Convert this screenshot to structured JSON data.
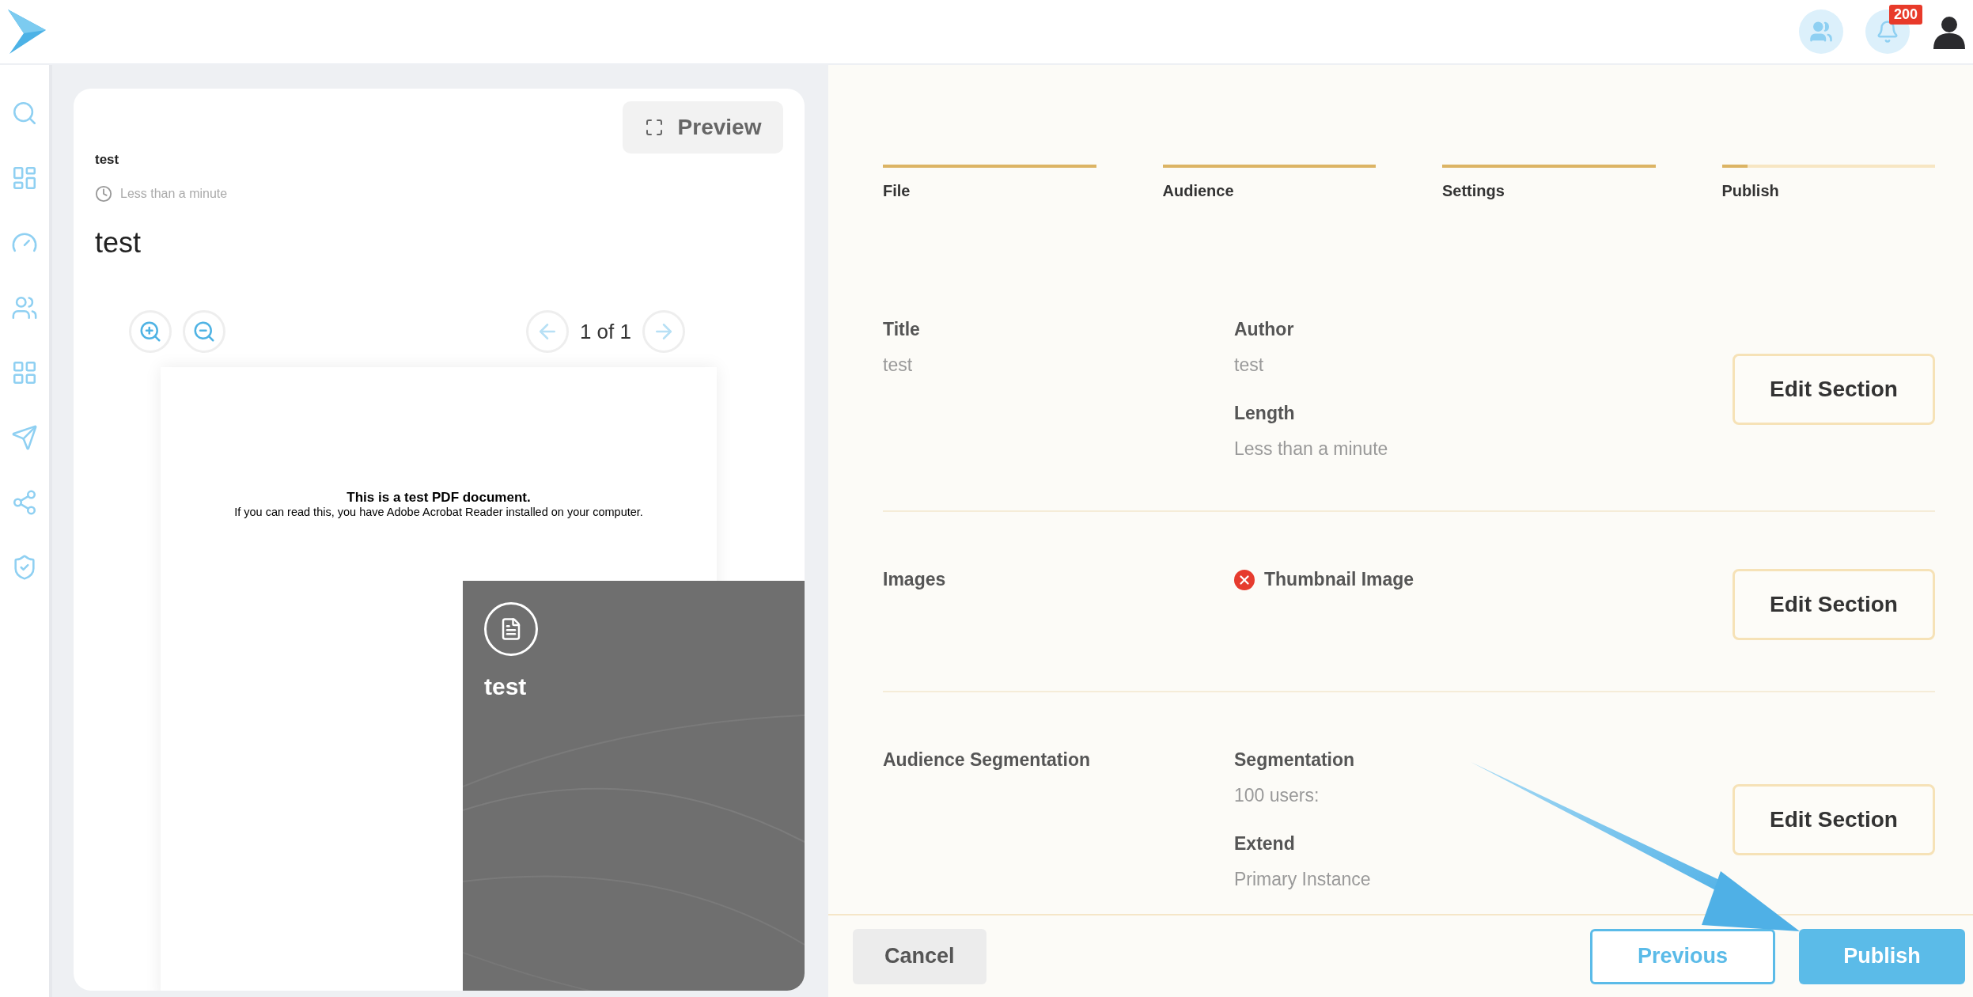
{
  "top_bar": {
    "notification_badge": "200"
  },
  "sidebar": {
    "items": [
      {
        "kind": "search"
      },
      {
        "kind": "dashboard"
      },
      {
        "kind": "gauge"
      },
      {
        "kind": "users"
      },
      {
        "kind": "apps"
      },
      {
        "kind": "send"
      },
      {
        "kind": "share"
      },
      {
        "kind": "shield"
      }
    ]
  },
  "preview_card": {
    "preview_button": "Preview",
    "small_title": "test",
    "duration": "Less than a minute",
    "title": "test",
    "page_indicator": "1 of 1",
    "pdf_page": {
      "heading": "This is a test PDF document.",
      "text": "If you can read this, you have Adobe Acrobat Reader installed on your computer."
    },
    "cover": {
      "title": "test"
    }
  },
  "steps": [
    {
      "label": "File",
      "level": 1
    },
    {
      "label": "Audience",
      "level": 1
    },
    {
      "label": "Settings",
      "level": 1
    },
    {
      "label": "Publish",
      "level": 0.12
    }
  ],
  "sections": [
    {
      "fields": [
        {
          "label": "Title",
          "value": "test"
        }
      ],
      "fields_2": [
        {
          "label": "Author",
          "value": "test"
        },
        {
          "label": "Length",
          "value": "Less than a minute"
        }
      ],
      "button": "Edit Section"
    },
    {
      "fields": [
        {
          "label": "Images"
        }
      ],
      "fields_2": [
        {
          "label": "Thumbnail Image",
          "has_error": true
        }
      ],
      "button": "Edit Section"
    },
    {
      "fields": [
        {
          "label": "Audience Segmentation"
        }
      ],
      "fields_2": [
        {
          "label": "Segmentation",
          "value": "100 users:"
        },
        {
          "label": "Extend",
          "value": "Primary Instance"
        }
      ],
      "button": "Edit Section"
    }
  ],
  "footer": {
    "cancel": "Cancel",
    "previous": "Previous",
    "publish": "Publish"
  }
}
